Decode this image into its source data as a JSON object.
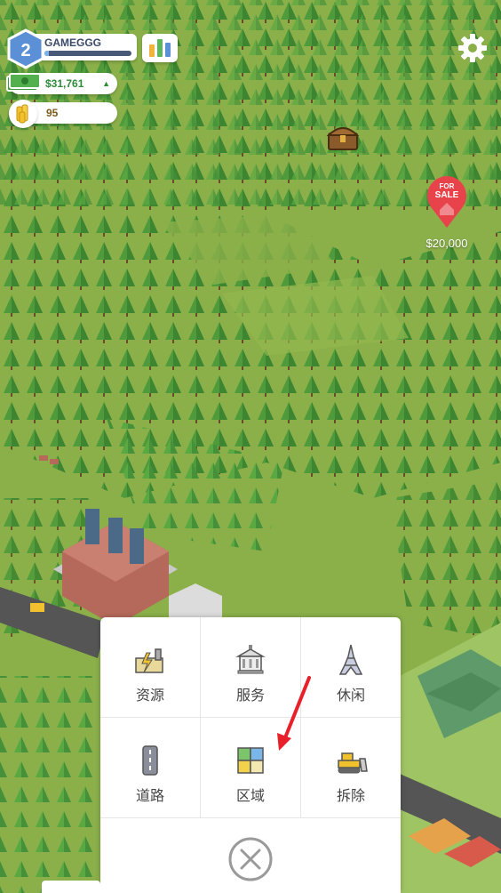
{
  "player": {
    "level": "2",
    "name": "GAMEGGG",
    "xp_fraction": 0.05
  },
  "resources": {
    "money": "$31,761",
    "money_trend": "▲",
    "coins": "95"
  },
  "map": {
    "for_sale_line1": "FOR",
    "for_sale_line2": "SALE",
    "for_sale_price": "$20,000"
  },
  "build_menu": {
    "items": [
      {
        "label": "资源",
        "icon": "power-plant-icon"
      },
      {
        "label": "服务",
        "icon": "city-hall-icon"
      },
      {
        "label": "休闲",
        "icon": "eiffel-tower-icon"
      },
      {
        "label": "道路",
        "icon": "road-icon"
      },
      {
        "label": "区域",
        "icon": "zone-grid-icon"
      },
      {
        "label": "拆除",
        "icon": "bulldozer-icon"
      }
    ],
    "close_icon": "close-circle-icon"
  },
  "colors": {
    "grass": "#8bb04a",
    "level_badge": "#5b8fd6",
    "money_green": "#2e8b3a",
    "for_sale_red": "#e8434b",
    "arrow_red": "#e8202a"
  }
}
